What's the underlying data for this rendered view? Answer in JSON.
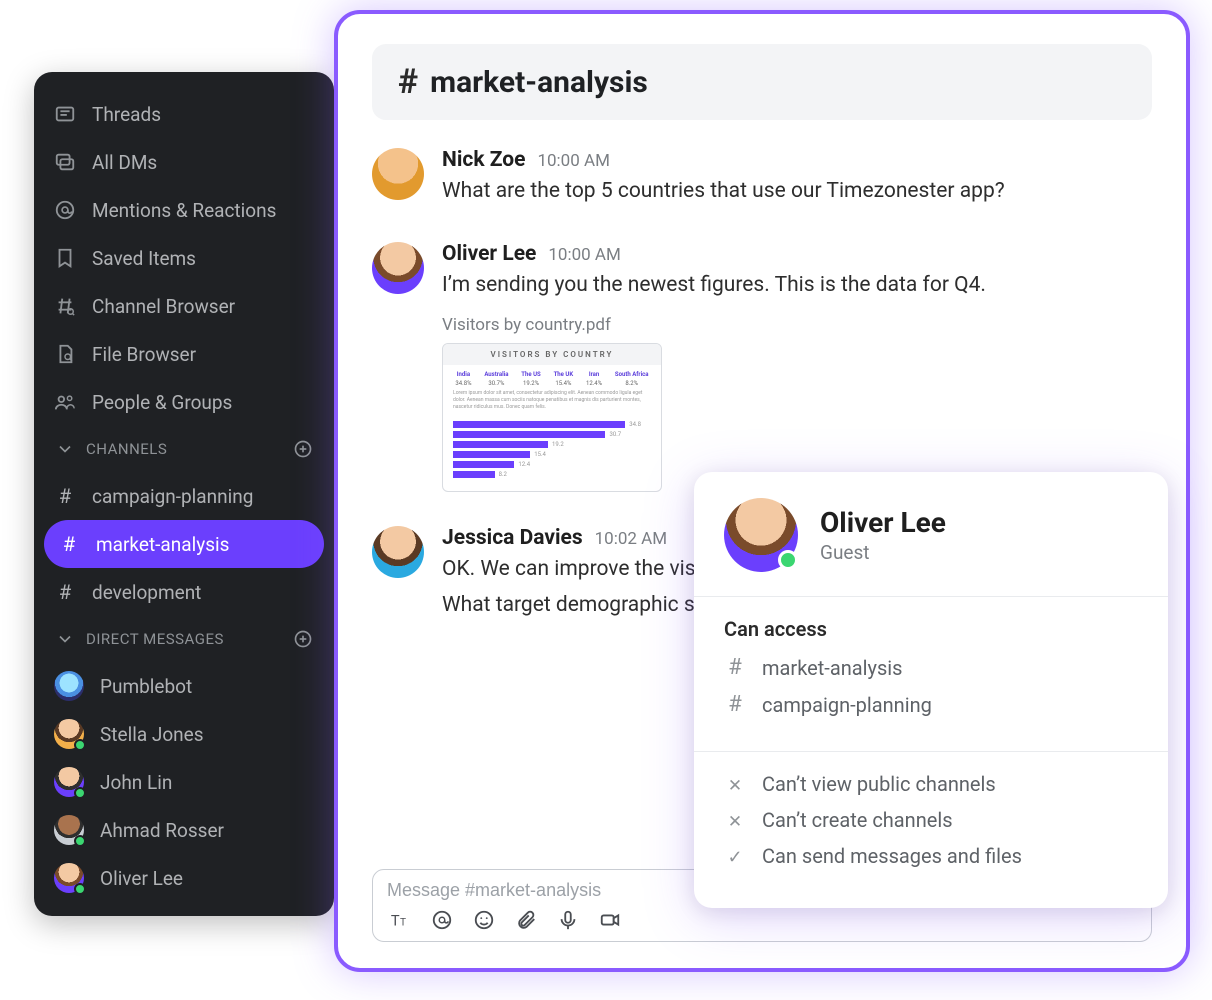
{
  "sidebar": {
    "nav": [
      {
        "icon": "threads-icon",
        "label": "Threads"
      },
      {
        "icon": "dms-icon",
        "label": "All DMs"
      },
      {
        "icon": "mentions-icon",
        "label": "Mentions & Reactions"
      },
      {
        "icon": "bookmark-icon",
        "label": "Saved Items"
      },
      {
        "icon": "channel-browser-icon",
        "label": "Channel Browser"
      },
      {
        "icon": "file-browser-icon",
        "label": "File Browser"
      },
      {
        "icon": "people-icon",
        "label": "People & Groups"
      }
    ],
    "channels_header": "CHANNELS",
    "channels": [
      {
        "name": "campaign-planning",
        "active": false
      },
      {
        "name": "market-analysis",
        "active": true
      },
      {
        "name": "development",
        "active": false
      }
    ],
    "dms_header": "DIRECT MESSAGES",
    "dms": [
      {
        "name": "Pumblebot",
        "avatar": "av-bot",
        "online": false
      },
      {
        "name": "Stella Jones",
        "avatar": "av-stella",
        "online": true
      },
      {
        "name": "John Lin",
        "avatar": "av-john",
        "online": true
      },
      {
        "name": "Ahmad Rosser",
        "avatar": "av-ahmad",
        "online": true
      },
      {
        "name": "Oliver Lee",
        "avatar": "av-oliver",
        "online": true
      }
    ]
  },
  "chat": {
    "channel": "market-analysis",
    "composer_placeholder": "Message #market-analysis",
    "messages": [
      {
        "author": "Nick Zoe",
        "avatar": "av-nick",
        "ts": "10:00 AM",
        "text": "What are the top 5 countries that use our Timezonester app?"
      },
      {
        "author": "Oliver Lee",
        "avatar": "av-oliver",
        "ts": "10:00 AM",
        "text": "I’m sending you the newest figures. This is the data for Q4.",
        "attachment": {
          "filename": "Visitors by country.pdf",
          "title": "VISITORS BY COUNTRY",
          "columns": [
            "India",
            "Australia",
            "The US",
            "The UK",
            "Iran",
            "South Africa"
          ],
          "values": [
            "34.8%",
            "30.7%",
            "19.2%",
            "15.4%",
            "12.4%",
            "8.2%"
          ]
        }
      },
      {
        "author": "Jessica Davies",
        "avatar": "av-jessica",
        "ts": "10:02 AM",
        "text": "OK. We can improve the visibility in the Scandinavian countries.",
        "text2": "What target demographic should we consider for the next campaign?"
      }
    ]
  },
  "popover": {
    "name": "Oliver Lee",
    "role": "Guest",
    "access_header": "Can access",
    "access_channels": [
      "market-analysis",
      "campaign-planning"
    ],
    "restrictions": [
      {
        "kind": "deny",
        "text": "Can’t view public channels"
      },
      {
        "kind": "deny",
        "text": "Can’t create channels"
      },
      {
        "kind": "allow",
        "text": "Can send messages and files"
      }
    ]
  },
  "chart_data": {
    "type": "bar",
    "orientation": "horizontal",
    "title": "VISITORS BY COUNTRY",
    "categories": [
      "India",
      "Australia",
      "The US",
      "The UK",
      "Iran",
      "South Africa"
    ],
    "values": [
      34.8,
      30.7,
      19.2,
      15.4,
      12.4,
      8.2
    ],
    "unit": "%",
    "xlabel": "",
    "ylabel": "",
    "xlim": [
      0,
      40
    ]
  }
}
